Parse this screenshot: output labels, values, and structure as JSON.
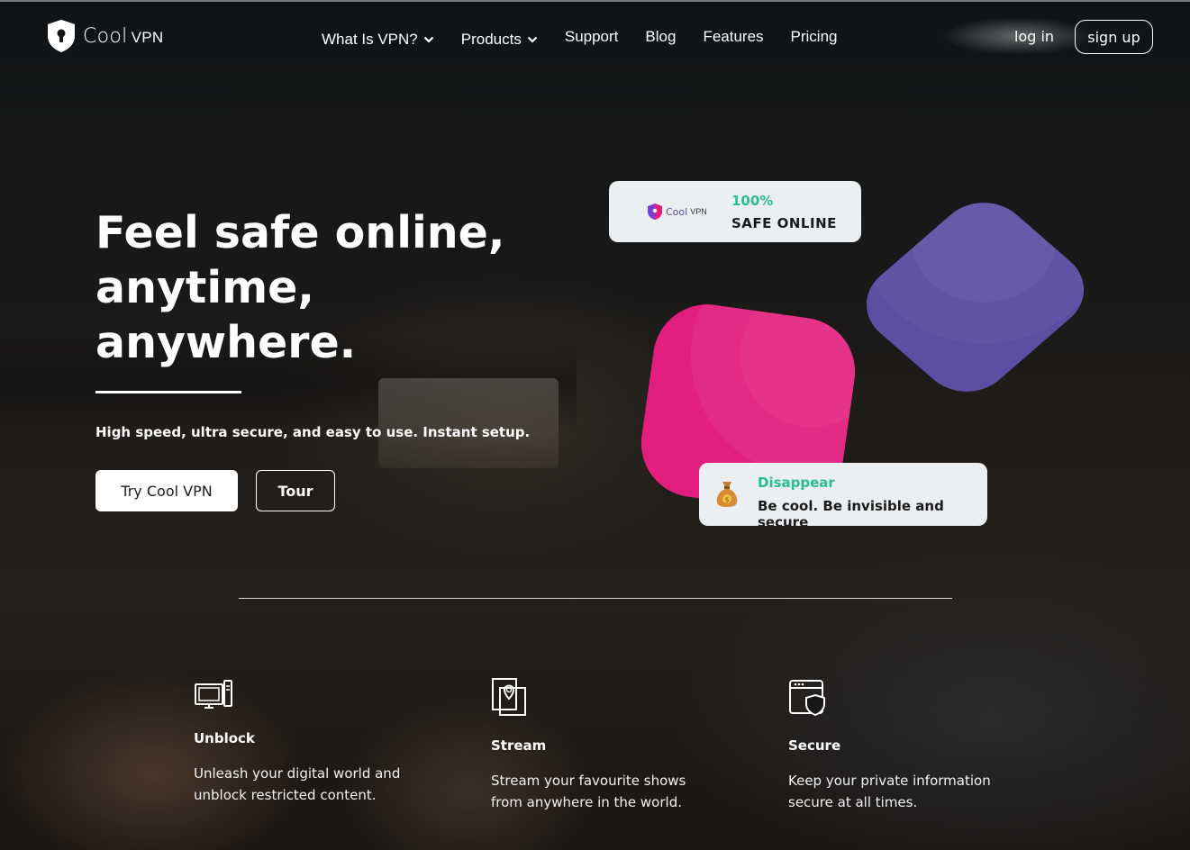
{
  "brand": {
    "name_part1": "Cool",
    "name_part2": "VPN"
  },
  "nav": {
    "items": [
      {
        "label": "What Is VPN?",
        "dropdown": true
      },
      {
        "label": "Products",
        "dropdown": true
      },
      {
        "label": "Support",
        "dropdown": false
      },
      {
        "label": "Blog",
        "dropdown": false
      },
      {
        "label": "Features",
        "dropdown": false
      },
      {
        "label": "Pricing",
        "dropdown": false
      }
    ],
    "login_label": "log in",
    "signup_label": "sign up"
  },
  "hero": {
    "title_lines": [
      "Feel safe online,",
      "anytime,",
      "anywhere."
    ],
    "subtitle": "High speed, ultra secure, and easy to use. Instant setup.",
    "primary_button": "Try Cool VPN",
    "secondary_button": "Tour"
  },
  "cards": {
    "safe": {
      "logo_text": "Cool",
      "logo_vpn": "VPN",
      "percent": "100%",
      "label": "SAFE ONLINE"
    },
    "disappear": {
      "title": "Disappear",
      "text": "Be cool. Be invisible and secure",
      "icon": "money-bag-icon"
    }
  },
  "colors": {
    "accent_green": "#2bbd8e",
    "shape_purple": "#5b4ea3",
    "shape_pink": "#e21f7e",
    "card_bg": "#eceff1"
  },
  "features": [
    {
      "icon": "monitor-icon",
      "title": "Unblock",
      "description_lines": [
        "Unleash your digital world and",
        "unblock restricted content."
      ]
    },
    {
      "icon": "location-pin-icon",
      "title": "Stream",
      "description_lines": [
        "Stream your favourite shows",
        "from anywhere in the world."
      ]
    },
    {
      "icon": "browser-shield-icon",
      "title": "Secure",
      "description_lines": [
        "Keep your private information",
        "secure at all times."
      ]
    }
  ]
}
